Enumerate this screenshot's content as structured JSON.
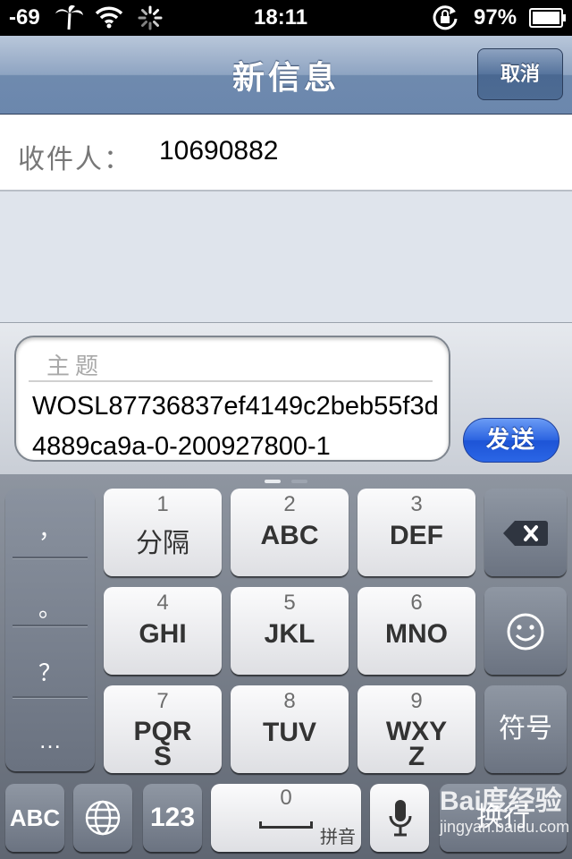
{
  "status": {
    "signal": "-69",
    "time": "18:11",
    "battery": "97%",
    "icons": [
      "palm-tree-icon",
      "wifi-icon",
      "activity-spinner-icon",
      "rotation-lock-icon",
      "battery-icon"
    ]
  },
  "nav": {
    "title": "新信息",
    "cancel": "取消"
  },
  "recipient": {
    "label": "收件人：",
    "value": "10690882"
  },
  "compose": {
    "subject_placeholder": "主题",
    "body": "WOSL87736837ef4149c2beb55f3d4889ca9a-0-200927800-1",
    "send": "发送"
  },
  "keyboard": {
    "punctuation": [
      "，",
      "。",
      "？",
      "…"
    ],
    "keys": [
      {
        "num": "1",
        "label": "分隔"
      },
      {
        "num": "2",
        "label": "ABC"
      },
      {
        "num": "3",
        "label": "DEF"
      },
      {
        "num": "4",
        "label": "GHI"
      },
      {
        "num": "5",
        "label": "JKL"
      },
      {
        "num": "6",
        "label": "MNO"
      },
      {
        "num": "7",
        "label": "PQRS"
      },
      {
        "num": "8",
        "label": "TUV"
      },
      {
        "num": "9",
        "label": "WXYZ"
      }
    ],
    "symbols": "符号",
    "abc": "ABC",
    "num123": "123",
    "space_num": "0",
    "space_label": "拼音",
    "return": "换行"
  },
  "watermark": {
    "brand": "Bai度经验",
    "url": "jingyan.baidu.com"
  }
}
